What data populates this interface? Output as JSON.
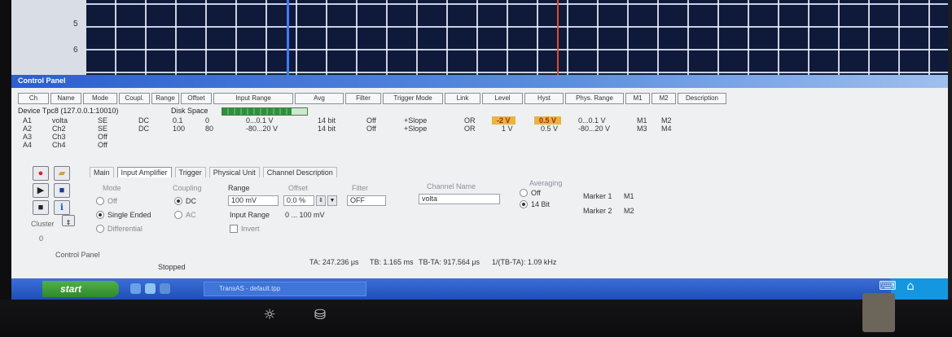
{
  "scope": {
    "y_ticks": [
      "5",
      "6"
    ]
  },
  "window": {
    "title": "Control Panel"
  },
  "columns": [
    "Ch",
    "Name",
    "Mode",
    "Coupl.",
    "Range",
    "Offset",
    "Input Range",
    "Avg",
    "Filter",
    "Trigger Mode",
    "Link",
    "Level",
    "Hyst",
    "Phys. Range",
    "M1",
    "M2",
    "Description"
  ],
  "device": {
    "label": "Device",
    "value": "Tpc8 (127.0.0.1:10010)",
    "disk_label": "Disk Space",
    "disk_fill_fraction": 0.82
  },
  "channels": [
    {
      "ch": "A1",
      "name": "volta",
      "mode": "SE",
      "coupl": "DC",
      "range": "0.1",
      "offset": "0",
      "input_range": "0...0.1 V",
      "avg": "14 bit",
      "filter": "Off",
      "trigger": "+Slope",
      "link": "OR",
      "level": "-2 V",
      "hyst": "0.5 V",
      "phys": "0...0.1 V",
      "m1": "M1",
      "m2": "M2"
    },
    {
      "ch": "A2",
      "name": "Ch2",
      "mode": "SE",
      "coupl": "DC",
      "range": "100",
      "offset": "80",
      "input_range": "-80...20 V",
      "avg": "14 bit",
      "filter": "Off",
      "trigger": "+Slope",
      "link": "OR",
      "level": "1 V",
      "hyst": "0.5 V",
      "phys": "-80...20 V",
      "m1": "M3",
      "m2": "M4"
    },
    {
      "ch": "A3",
      "name": "Ch3",
      "mode": "Off"
    },
    {
      "ch": "A4",
      "name": "Ch4",
      "mode": "Off"
    }
  ],
  "tabs": [
    "Main",
    "Input Amplifier",
    "Trigger",
    "Physical Unit",
    "Channel Description"
  ],
  "amplifier": {
    "mode_label": "Mode",
    "mode_off": "Off",
    "mode_single": "Single Ended",
    "mode_diff": "Differential",
    "coupling_label": "Coupling",
    "coupling_dc": "DC",
    "coupling_ac": "AC",
    "range_label": "Range",
    "range_value": "100 mV",
    "offset_label": "Offset",
    "offset_value": "0.0 %",
    "input_range_label": "Input Range",
    "input_range_value": "0 ... 100 mV",
    "invert_label": "Invert",
    "filter_label": "Filter",
    "filter_value": "OFF",
    "channel_name_label": "Channel Name",
    "channel_name_value": "volta",
    "avg_label": "Averaging",
    "avg_off": "Off",
    "avg_14": "14 Bit",
    "marker1_label": "Marker 1",
    "marker1_value": "M1",
    "marker2_label": "Marker 2",
    "marker2_value": "M2"
  },
  "left_controls": {
    "cluster_label": "Cluster",
    "cluster_value": "0"
  },
  "status": {
    "panel_label": "Control Panel",
    "state": "Stopped",
    "ta": "TA: 247.236 μs",
    "tb": "TB: 1.165 ms",
    "tb_ta": "TB-TA: 917.564 μs",
    "freq": "1/(TB-TA): 1.09 kHz"
  },
  "taskbar": {
    "start_label": "start",
    "task_label": "TransAS - default.tpp"
  },
  "colors": {
    "highlight": "#e8b43c",
    "title_blue": "#2a5fcf",
    "taskbar_blue": "#1e4fb8"
  }
}
